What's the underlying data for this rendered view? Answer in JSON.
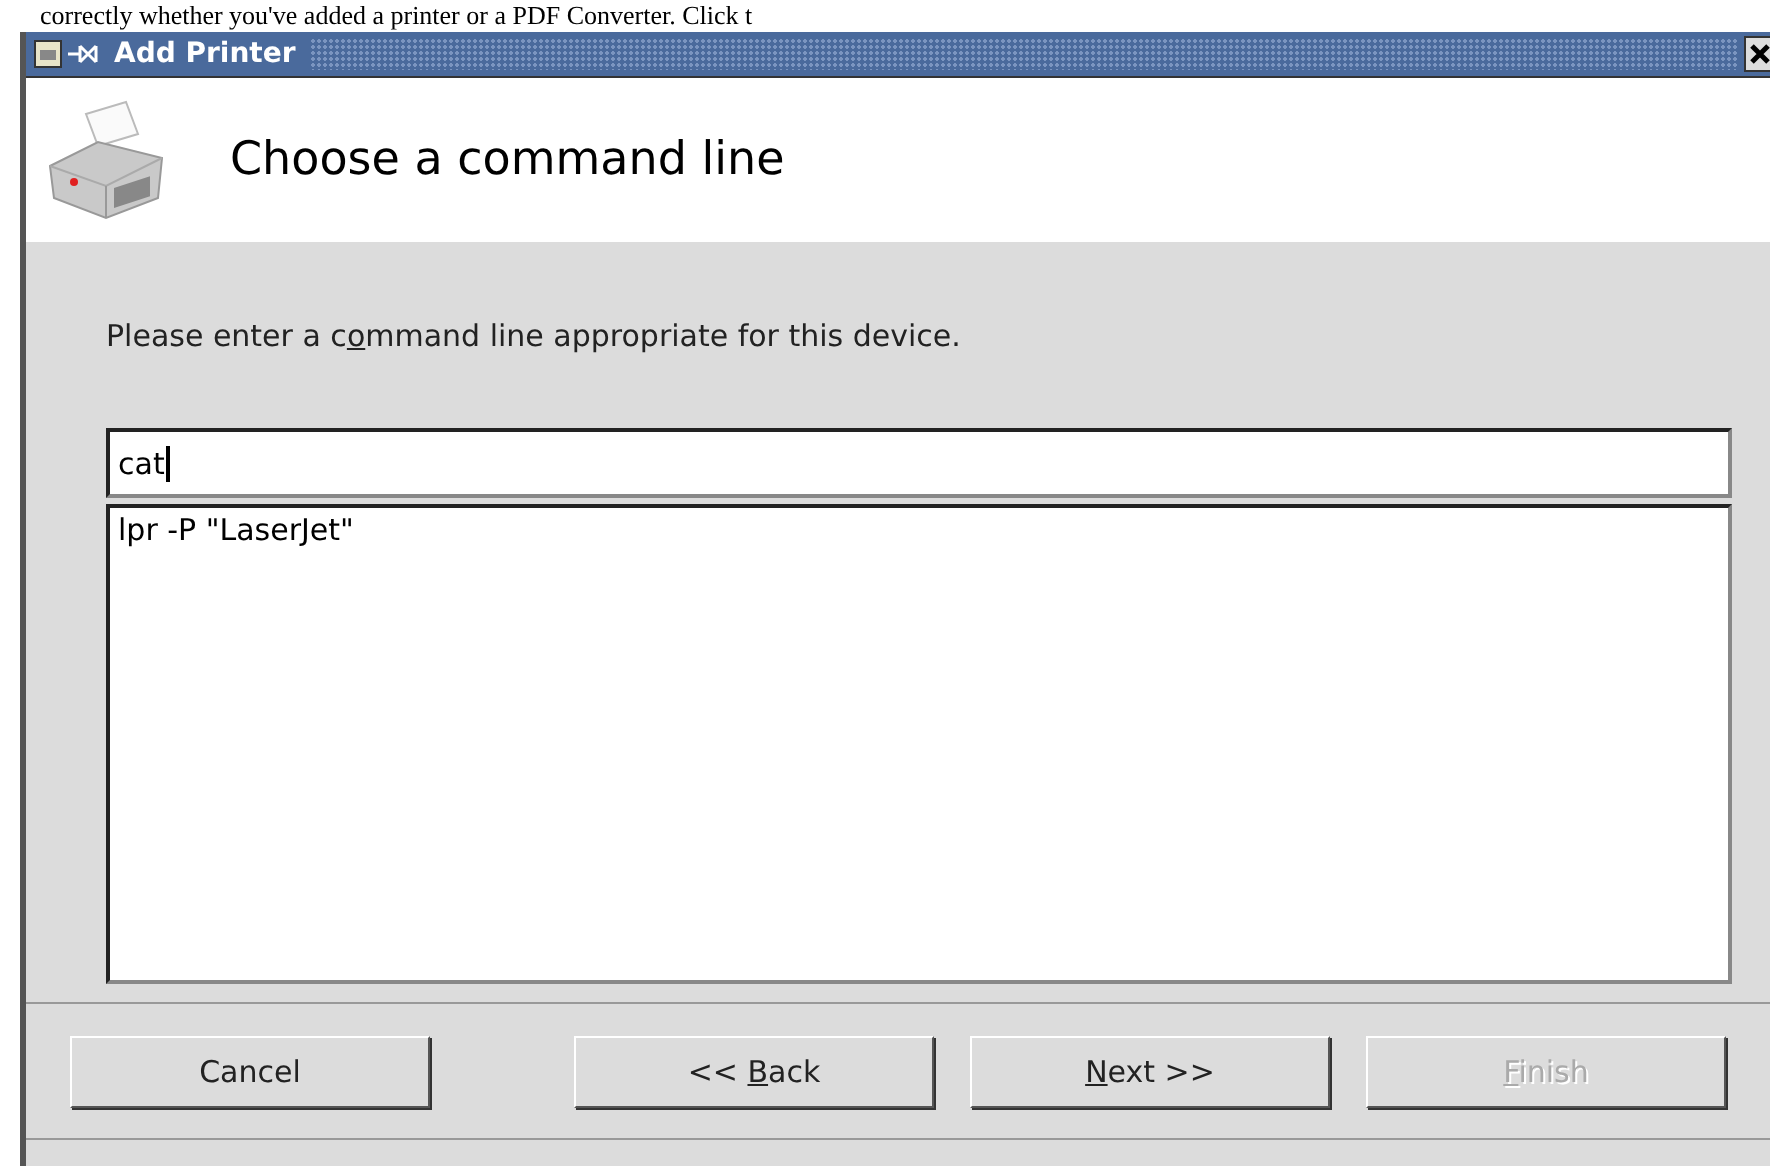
{
  "background_text": "correctly whether you've added a printer or a PDF Converter.  Click t",
  "window": {
    "title": "Add Printer"
  },
  "header": {
    "title": "Choose a command line"
  },
  "prompt": {
    "before_key": "Please enter a c",
    "access_key": "o",
    "after_key": "mmand line appropriate for this device."
  },
  "command_field": {
    "value": "cat"
  },
  "suggestions": [
    {
      "text": "lpr -P \"LaserJet\"",
      "selected": false
    }
  ],
  "buttons": [
    {
      "before_key": "Cancel",
      "disabled": false
    },
    {
      "before_key": "<< ",
      "access_key": "B",
      "after_key": "ack",
      "disabled": false
    },
    {
      "access_key": "N",
      "after_key": "ext >>",
      "disabled": false
    },
    {
      "access_key": "F",
      "after_key": "inish",
      "disabled": true
    }
  ]
}
